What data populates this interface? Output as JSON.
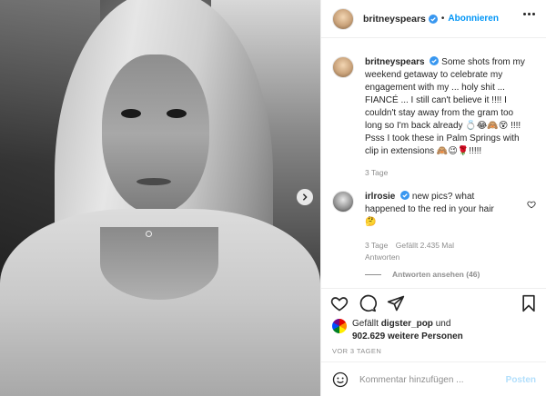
{
  "header": {
    "username": "britneyspears",
    "separator": "•",
    "follow_label": "Abonnieren"
  },
  "caption": {
    "username": "britneyspears",
    "text": "Some shots from my weekend getaway to celebrate my engagement with my ... holy shit ... FIANCÉ ... I still can't believe it !!!! I couldn't stay away from the gram too long so I'm back already 💍😂🙈😵 !!!! Psss I took these in Palm Springs with clip in extensions 🙈😉🌹!!!!!",
    "time": "3 Tage"
  },
  "comment": {
    "username": "irlrosie",
    "text": "new pics? what happened to the red in your hair 🤔",
    "time": "3 Tage",
    "likes": "Gefällt 2.435 Mal",
    "reply": "Antworten",
    "view_replies": "Antworten ansehen (46)"
  },
  "likes": {
    "prefix": "Gefällt",
    "user": "digster_pop",
    "mid": "und",
    "count": "902.629",
    "suffix": "weitere Personen"
  },
  "posted_ago": "VOR 3 TAGEN",
  "add_comment": {
    "placeholder": "Kommentar hinzufügen ...",
    "post_label": "Posten"
  },
  "colors": {
    "accent": "#0095f6",
    "post_disabled": "#b2dffc",
    "muted": "#8e8e8e"
  }
}
